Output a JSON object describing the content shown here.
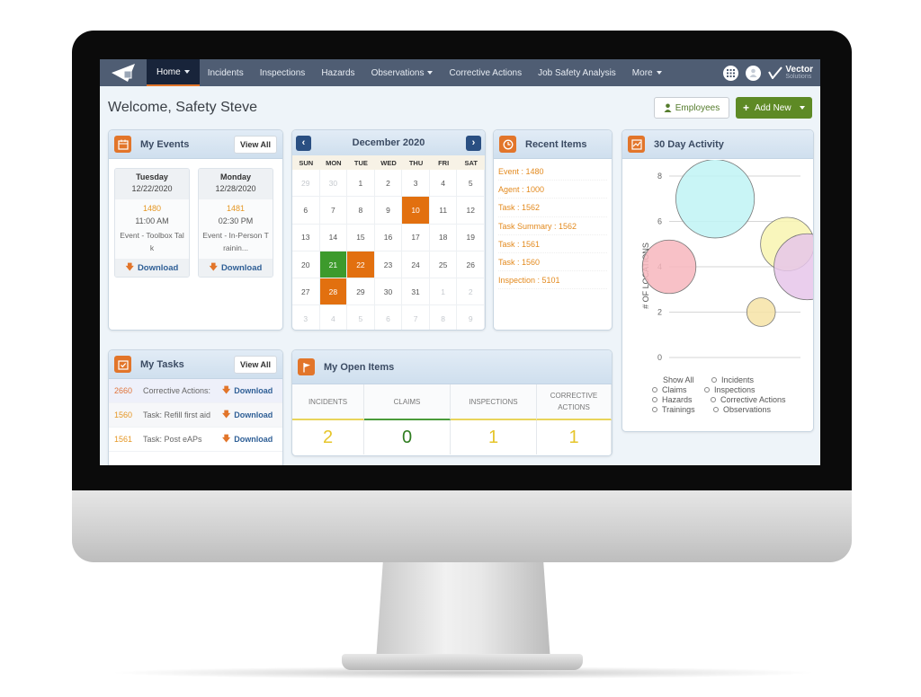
{
  "nav": {
    "items": [
      {
        "label": "Home",
        "dropdown": true,
        "active": true
      },
      {
        "label": "Incidents"
      },
      {
        "label": "Inspections"
      },
      {
        "label": "Hazards"
      },
      {
        "label": "Observations",
        "dropdown": true
      },
      {
        "label": "Corrective Actions"
      },
      {
        "label": "Job Safety Analysis"
      },
      {
        "label": "More",
        "dropdown": true
      }
    ],
    "brand_name": "Vector",
    "brand_sub": "Solutions"
  },
  "header": {
    "welcome": "Welcome, Safety Steve",
    "employees_label": "Employees",
    "add_new_label": "Add New",
    "accent_green": "#5e8a25",
    "accent_orange": "#e2752a"
  },
  "events": {
    "title": "My Events",
    "view_all": "View All",
    "cards": [
      {
        "day": "Tuesday",
        "date": "12/22/2020",
        "id": "1480",
        "time": "11:00 AM",
        "desc": "Event - Toolbox Tal k",
        "download": "Download"
      },
      {
        "day": "Monday",
        "date": "12/28/2020",
        "id": "1481",
        "time": "02:30 PM",
        "desc": "Event - In-Person T rainin...",
        "download": "Download"
      }
    ]
  },
  "calendar": {
    "title": "December 2020",
    "prev": "‹",
    "next": "›",
    "dow": [
      "SUN",
      "MON",
      "TUE",
      "WED",
      "THU",
      "FRI",
      "SAT"
    ],
    "days": [
      {
        "d": "29",
        "m": true
      },
      {
        "d": "30",
        "m": true
      },
      {
        "d": "1"
      },
      {
        "d": "2"
      },
      {
        "d": "3"
      },
      {
        "d": "4"
      },
      {
        "d": "5"
      },
      {
        "d": "6"
      },
      {
        "d": "7"
      },
      {
        "d": "8"
      },
      {
        "d": "9"
      },
      {
        "d": "10",
        "h": "orange"
      },
      {
        "d": "11"
      },
      {
        "d": "12"
      },
      {
        "d": "13"
      },
      {
        "d": "14"
      },
      {
        "d": "15"
      },
      {
        "d": "16"
      },
      {
        "d": "17"
      },
      {
        "d": "18"
      },
      {
        "d": "19"
      },
      {
        "d": "20"
      },
      {
        "d": "21",
        "h": "green"
      },
      {
        "d": "22",
        "h": "orange"
      },
      {
        "d": "23"
      },
      {
        "d": "24"
      },
      {
        "d": "25"
      },
      {
        "d": "26"
      },
      {
        "d": "27"
      },
      {
        "d": "28",
        "h": "orange"
      },
      {
        "d": "29"
      },
      {
        "d": "30"
      },
      {
        "d": "31"
      },
      {
        "d": "1",
        "m": true
      },
      {
        "d": "2",
        "m": true
      },
      {
        "d": "3",
        "m": true
      },
      {
        "d": "4",
        "m": true
      },
      {
        "d": "5",
        "m": true
      },
      {
        "d": "6",
        "m": true
      },
      {
        "d": "7",
        "m": true
      },
      {
        "d": "8",
        "m": true
      },
      {
        "d": "9",
        "m": true
      }
    ]
  },
  "recent": {
    "title": "Recent Items",
    "items": [
      "Event : 1480",
      "Agent : 1000",
      "Task : 1562",
      "Task Summary : 1562",
      "Task : 1561",
      "Task : 1560",
      "Inspection : 5101"
    ]
  },
  "activity": {
    "title": "30 Day Activity",
    "chart_data": {
      "type": "scatter",
      "title": "30 Day Activity",
      "ylabel": "# OF LOCATIONS",
      "xlabel": "",
      "ylim": [
        0,
        8
      ],
      "yticks": [
        "0",
        "2",
        "4",
        "6",
        "8"
      ],
      "grid": true,
      "bubbles": [
        {
          "x": 0.0,
          "y": 4,
          "size": 4,
          "color": "#f7b6bd"
        },
        {
          "x": 0.35,
          "y": 7,
          "size": 6,
          "color": "#bff3f5"
        },
        {
          "x": 0.7,
          "y": 2,
          "size": 2,
          "color": "#f6e3a6"
        },
        {
          "x": 0.9,
          "y": 5,
          "size": 4,
          "color": "#f8f5b0"
        },
        {
          "x": 1.05,
          "y": 4,
          "size": 5,
          "color": "#e6c6ea"
        }
      ]
    },
    "legend": {
      "show_all": "Show All",
      "items": [
        "Incidents",
        "Claims",
        "Inspections",
        "Hazards",
        "Corrective Actions",
        "Trainings",
        "Observations"
      ]
    }
  },
  "tasks": {
    "title": "My Tasks",
    "view_all": "View All",
    "rows": [
      {
        "id": "2660",
        "text": "Corrective Actions:",
        "download": "Download"
      },
      {
        "id": "1560",
        "text": "Task: Refill first aid",
        "download": "Download"
      },
      {
        "id": "1561",
        "text": "Task: Post eAPs",
        "download": "Download"
      }
    ]
  },
  "open_items": {
    "title": "My Open Items",
    "columns": [
      {
        "label": "INCIDENTS",
        "value": "2"
      },
      {
        "label": "CLAIMS",
        "value": "0"
      },
      {
        "label": "INSPECTIONS",
        "value": "1"
      },
      {
        "label": "CORRECTIVE ACTIONS",
        "value": "1"
      }
    ]
  }
}
